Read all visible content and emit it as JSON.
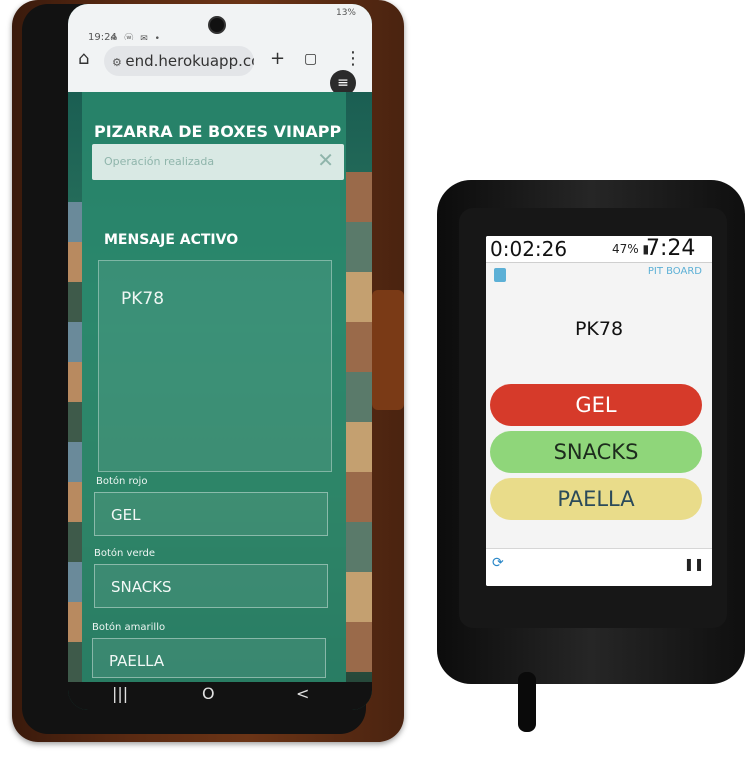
{
  "phone": {
    "status": {
      "time": "19:24",
      "icons": "⊛ ⓦ ✉ •",
      "battery": "13%"
    },
    "browser": {
      "url": "end.herokuapp.com",
      "new_tab_icon": "+",
      "tabs_icon": "▢",
      "menu_icon": "⋮"
    },
    "page": {
      "title": "PIZARRA DE BOXES VINAPP",
      "toast": "Operación realizada",
      "active_message_label": "MENSAJE ACTIVO",
      "active_message": "PK78",
      "fields": [
        {
          "label": "Botón rojo",
          "value": "GEL"
        },
        {
          "label": "Botón verde",
          "value": "SNACKS"
        },
        {
          "label": "Botón amarillo",
          "value": "PAELLA"
        }
      ]
    },
    "nav": {
      "recents": "|||",
      "home": "O",
      "back": "<"
    }
  },
  "gps": {
    "timer": "0:02:26",
    "battery": "47%",
    "clock": "7:24",
    "board_label": "PIT BOARD",
    "message": "PK78",
    "buttons": [
      {
        "label": "GEL",
        "color": "#d63a2a",
        "text_color": "#ffffff"
      },
      {
        "label": "SNACKS",
        "color": "#8fd67a",
        "text_color": "#1d2b1d"
      },
      {
        "label": "PAELLA",
        "color": "#e9dc8a",
        "text_color": "#2b4a5a"
      }
    ]
  }
}
